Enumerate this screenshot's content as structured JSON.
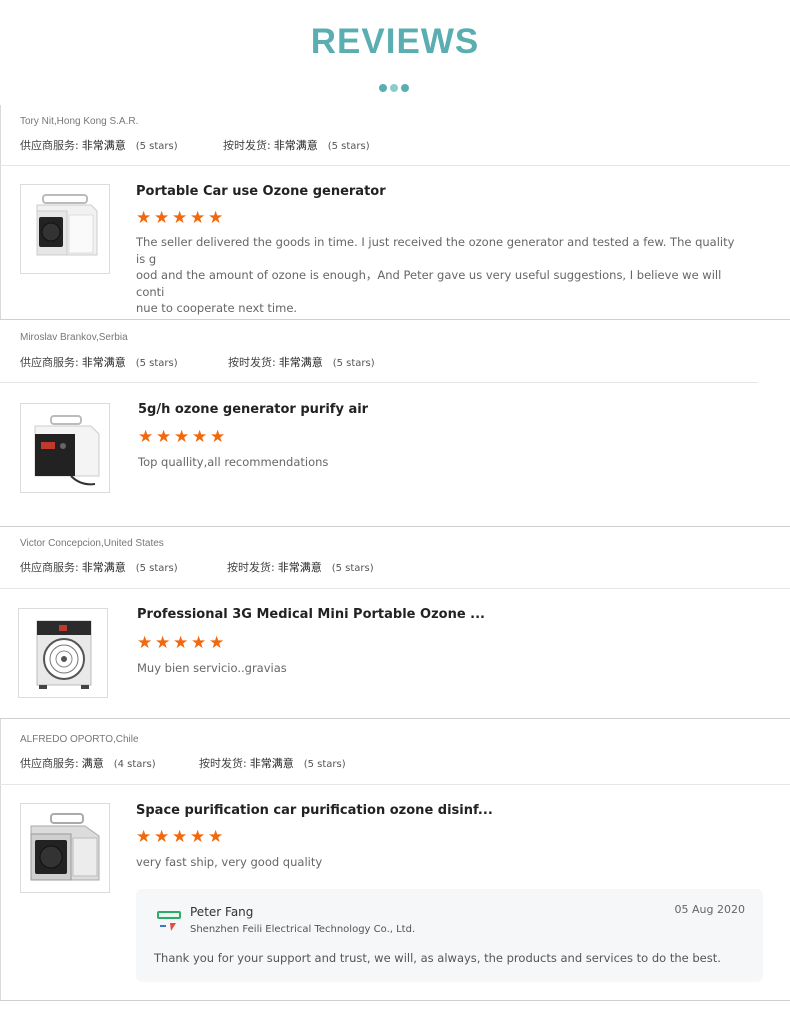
{
  "page": {
    "title": "REVIEWS"
  },
  "accent_color": "#5aaeb1",
  "star_color": "#f2680c",
  "rating_labels": {
    "service": "供应商服务:",
    "shipping": "按时发货:"
  },
  "reviews": [
    {
      "reviewer": "Tory Nit,Hong Kong S.A.R.",
      "service_value": "非常满意",
      "service_stars": "(5 stars)",
      "shipping_value": "非常满意",
      "shipping_stars": "(5 stars)",
      "product_title": "Portable Car use Ozone generator",
      "stars": 5,
      "comment": "The seller delivered the goods in time. I just received the ozone generator and tested a few. The quality is g ood and the amount of ozone is enough，And Peter gave us very useful suggestions, I believe we will conti nue to cooperate next time.",
      "comment_lines": [
        "The seller delivered the goods in time. I just received the ozone generator and tested a few. The quality is g",
        "ood and the amount of ozone is enough，And Peter gave us very useful suggestions, I believe we will conti",
        "nue to cooperate next time."
      ],
      "image_icon": "white-box-ozone-generator-icon"
    },
    {
      "reviewer": "Miroslav Brankov,Serbia",
      "service_value": "非常满意",
      "service_stars": "(5 stars)",
      "shipping_value": "非常满意",
      "shipping_stars": "(5 stars)",
      "product_title": "5g/h ozone generator purify air",
      "stars": 5,
      "comment": "Top quallity,all recommendations",
      "image_icon": "white-ozone-generator-with-display-icon"
    },
    {
      "reviewer": "Victor Concepcion,United States",
      "service_value": "非常满意",
      "service_stars": "(5 stars)",
      "shipping_value": "非常满意",
      "shipping_stars": "(5 stars)",
      "product_title": "Professional 3G Medical Mini Portable Ozone ...",
      "stars": 5,
      "comment": "Muy  bien servicio..gravias",
      "image_icon": "fan-ozone-generator-icon"
    },
    {
      "reviewer": "ALFREDO OPORTO,Chile",
      "service_value": "满意",
      "service_stars": "(4 stars)",
      "shipping_value": "非常满意",
      "shipping_stars": "(5 stars)",
      "product_title": "Space purification car purification ozone disinf...",
      "stars": 5,
      "comment": "very fast ship, very good quality",
      "image_icon": "silver-ozone-generator-icon",
      "reply": {
        "name": "Peter Fang",
        "company": "Shenzhen Feili Electrical Technology Co., Ltd.",
        "date": "05 Aug 2020",
        "text": "Thank you for your support and trust, we will, as always, the products and services to do the best.",
        "logo_icon": "company-logo-icon"
      }
    }
  ]
}
